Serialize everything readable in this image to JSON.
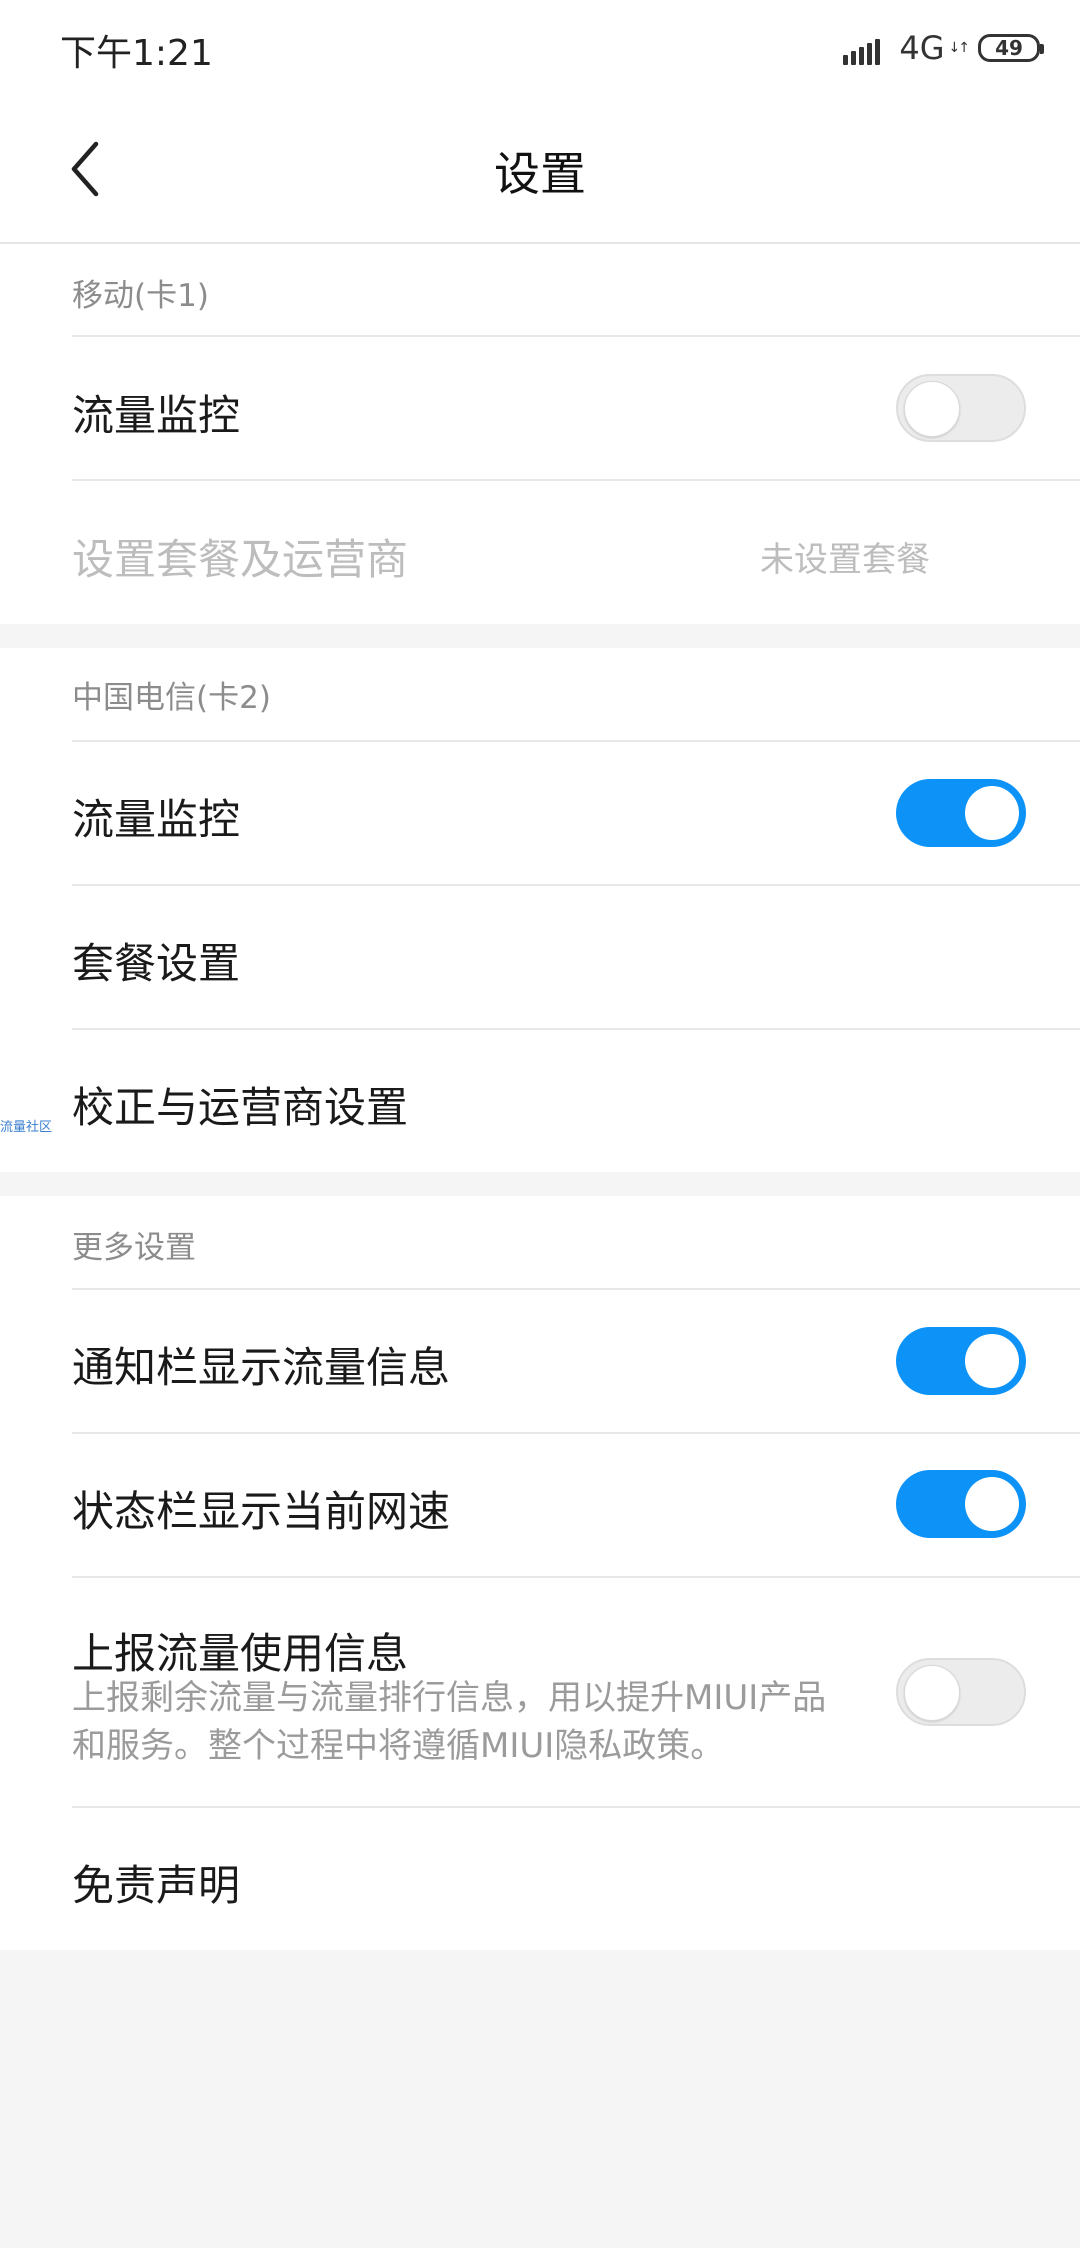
{
  "status_bar": {
    "time": "下午1:21",
    "network": "4G",
    "network_arrows": "↓↑",
    "battery": "49"
  },
  "header": {
    "title": "设置",
    "back_icon": "chevron-left-icon"
  },
  "sim1": {
    "header": "移动(卡1)",
    "traffic_monitor_label": "流量监控",
    "traffic_monitor_on": false,
    "plan_label": "设置套餐及运营商",
    "plan_value": "未设置套餐"
  },
  "sim2": {
    "header": "中国电信(卡2)",
    "traffic_monitor_label": "流量监控",
    "traffic_monitor_on": true,
    "plan_settings_label": "套餐设置",
    "calibration_label": "校正与运营商设置"
  },
  "watermark": "流量社区",
  "more": {
    "header": "更多设置",
    "notification_label": "通知栏显示流量信息",
    "notification_on": true,
    "statusbar_label": "状态栏显示当前网速",
    "statusbar_on": true,
    "report_label": "上报流量使用信息",
    "report_desc": "上报剩余流量与流量排行信息，用以提升MIUI产品和服务。整个过程中将遵循MIUI隐私政策。",
    "report_on": false,
    "disclaimer_label": "免责声明"
  },
  "colors": {
    "accent": "#0d93f7",
    "background": "#f5f5f5"
  }
}
